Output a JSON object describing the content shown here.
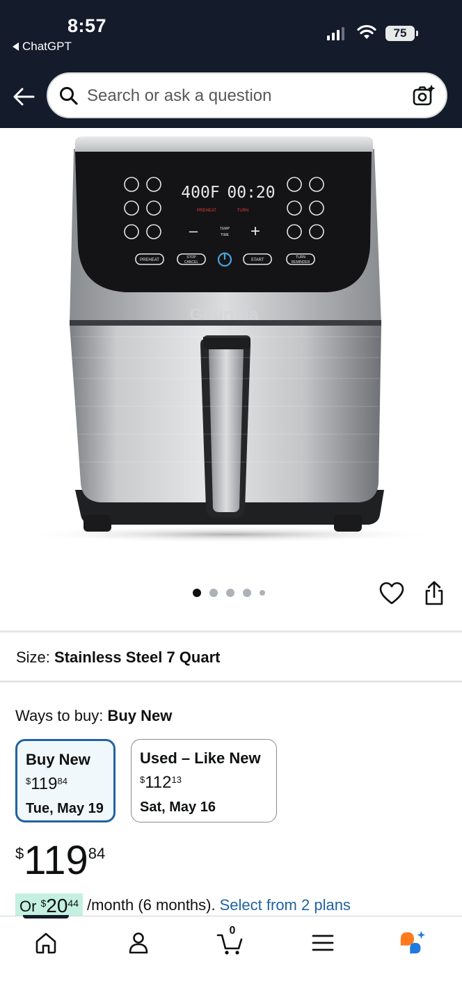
{
  "status_bar": {
    "time": "8:57",
    "back_app_label": "ChatGPT",
    "battery": "75"
  },
  "header": {
    "search_placeholder": "Search or ask a question",
    "colors": {
      "background": "#141b2b"
    }
  },
  "product": {
    "image_icon": "air-fryer-product-image",
    "display": {
      "temp": "400F",
      "time": "00:20",
      "preheat": "PREHEAT",
      "turn": "TURN",
      "temp_time": "TEMP TIME",
      "buttons": [
        "PREHEAT",
        "STOP CANCEL",
        "START",
        "TURN REMINDER"
      ],
      "brand": "Gourmia"
    },
    "carousel": {
      "count": 5,
      "active_index": 0
    }
  },
  "size": {
    "label": "Size:",
    "value": "Stainless Steel 7 Quart"
  },
  "ways_to_buy": {
    "label": "Ways to buy:",
    "value": "Buy New",
    "options": [
      {
        "title": "Buy New",
        "currency": "$",
        "whole": "119",
        "fraction": "84",
        "date": "Tue, May 19",
        "selected": true
      },
      {
        "title": "Used – Like New",
        "currency": "$",
        "whole": "112",
        "fraction": "13",
        "date": "Sat, May 16",
        "selected": false
      }
    ]
  },
  "price": {
    "currency": "$",
    "whole": "119",
    "fraction": "84"
  },
  "financing": {
    "prefix": "Or",
    "currency": "$",
    "whole": "20",
    "fraction": "44",
    "suffix": "/month (6 months).",
    "link": "Select from 2 plans",
    "colors": {
      "highlight": "#c4f0e1",
      "link": "#2162a1"
    }
  },
  "bottom_nav": {
    "cart_count": "0",
    "items": [
      "home-icon",
      "account-icon",
      "cart-icon",
      "menu-icon",
      "rufus-icon"
    ]
  }
}
